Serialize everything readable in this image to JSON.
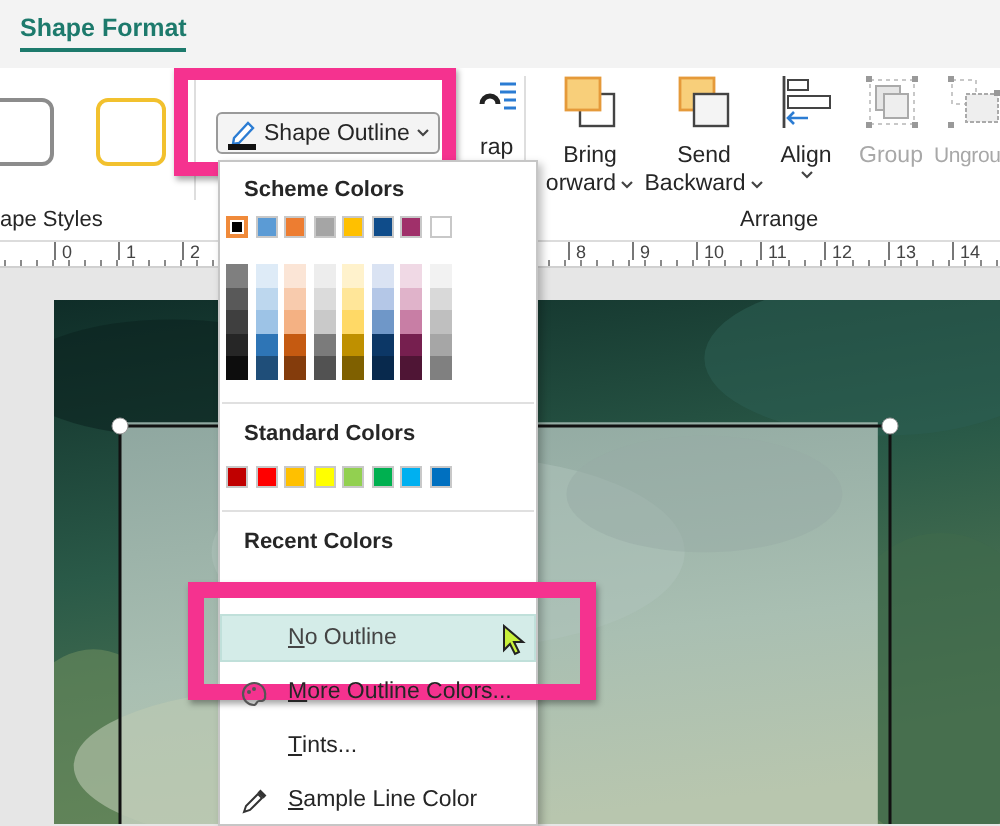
{
  "tab": {
    "label": "Shape Format",
    "selected": true
  },
  "shape_styles": {
    "swatches": [
      {
        "color": "#8c8c8c"
      },
      {
        "color": "#f2c12e"
      }
    ],
    "group_label": "ape Styles"
  },
  "shape_outline_button": {
    "label": "Shape Outline",
    "annotated": true
  },
  "wrap": {
    "label": "rap"
  },
  "arrange": {
    "group_label": "Arrange",
    "buttons": [
      {
        "kind": "bring_forward",
        "lines": [
          "Bring",
          "orward"
        ],
        "dropdown": true,
        "disabled": false
      },
      {
        "kind": "send_backward",
        "lines": [
          "Send",
          "Backward"
        ],
        "dropdown": true,
        "disabled": false
      },
      {
        "kind": "align",
        "lines": [
          "Align"
        ],
        "dropdown": true,
        "disabled": false
      },
      {
        "kind": "group",
        "lines": [
          "Group"
        ],
        "dropdown": false,
        "disabled": true
      },
      {
        "kind": "ungroup",
        "lines": [
          "Ungrou"
        ],
        "dropdown": false,
        "disabled": true
      }
    ]
  },
  "ruler": {
    "left_labels": [
      "0",
      "1",
      "2"
    ],
    "right_labels": [
      "8",
      "9",
      "10",
      "11",
      "12",
      "13",
      "14"
    ]
  },
  "menu": {
    "scheme_title": "Scheme Colors",
    "scheme_colors": [
      {
        "color": "#000000",
        "selected": true,
        "shades": [
          {
            "color": "#7f7f7f"
          },
          {
            "color": "#595959"
          },
          {
            "color": "#3f3f3f"
          },
          {
            "color": "#262626"
          },
          {
            "color": "#0d0d0d"
          }
        ]
      },
      {
        "color": "#5b9bd5",
        "selected": false,
        "shades": [
          {
            "color": "#deebf7"
          },
          {
            "color": "#bdd7ee"
          },
          {
            "color": "#9dc3e6"
          },
          {
            "color": "#2e75b6"
          },
          {
            "color": "#1f4e79"
          }
        ]
      },
      {
        "color": "#ed7d31",
        "selected": false,
        "shades": [
          {
            "color": "#fbe5d6"
          },
          {
            "color": "#f8cbad"
          },
          {
            "color": "#f4b183"
          },
          {
            "color": "#c55a11"
          },
          {
            "color": "#843c0c"
          }
        ]
      },
      {
        "color": "#a5a5a5",
        "selected": false,
        "shades": [
          {
            "color": "#ededed"
          },
          {
            "color": "#dbdbdb"
          },
          {
            "color": "#c9c9c9"
          },
          {
            "color": "#7b7b7b"
          },
          {
            "color": "#525252"
          }
        ]
      },
      {
        "color": "#ffc000",
        "selected": false,
        "shades": [
          {
            "color": "#fff2cc"
          },
          {
            "color": "#ffe699"
          },
          {
            "color": "#ffd966"
          },
          {
            "color": "#bf9000"
          },
          {
            "color": "#7f6000"
          }
        ]
      },
      {
        "color": "#0f4c8a",
        "selected": false,
        "shades": [
          {
            "color": "#dae3f3"
          },
          {
            "color": "#b4c7e7"
          },
          {
            "color": "#6f97c8"
          },
          {
            "color": "#0c3766"
          },
          {
            "color": "#08294d"
          }
        ]
      },
      {
        "color": "#a0306a",
        "selected": false,
        "shades": [
          {
            "color": "#f0d9e5"
          },
          {
            "color": "#e0b3ca"
          },
          {
            "color": "#c87ea5"
          },
          {
            "color": "#761f4f"
          },
          {
            "color": "#4f1535"
          }
        ]
      },
      {
        "color": "#ffffff",
        "selected": false,
        "shades": [
          {
            "color": "#f2f2f2"
          },
          {
            "color": "#d9d9d9"
          },
          {
            "color": "#bfbfbf"
          },
          {
            "color": "#a6a6a6"
          },
          {
            "color": "#808080"
          }
        ]
      }
    ],
    "standard_title": "Standard Colors",
    "standard_colors": [
      {
        "color": "#c00000"
      },
      {
        "color": "#ff0000"
      },
      {
        "color": "#ffc000"
      },
      {
        "color": "#ffff00"
      },
      {
        "color": "#92d050"
      },
      {
        "color": "#00b050"
      },
      {
        "color": "#00b0f0"
      },
      {
        "color": "#0070c0"
      }
    ],
    "recent_title": "Recent Colors",
    "items": [
      {
        "kind": "no_outline",
        "access_key": "N",
        "rest": "o Outline",
        "hover": true,
        "annotated": true
      },
      {
        "kind": "more_colors",
        "access_key": "M",
        "rest": "ore Outline Colors...",
        "hover": false,
        "annotated": false
      },
      {
        "kind": "tints",
        "access_key": "T",
        "rest": "ints...",
        "hover": false,
        "annotated": false
      },
      {
        "kind": "sample",
        "access_key": "S",
        "rest": "ample Line Color",
        "hover": false,
        "annotated": false
      }
    ]
  },
  "slide": {
    "kind": "picture",
    "shape_selected": true
  }
}
